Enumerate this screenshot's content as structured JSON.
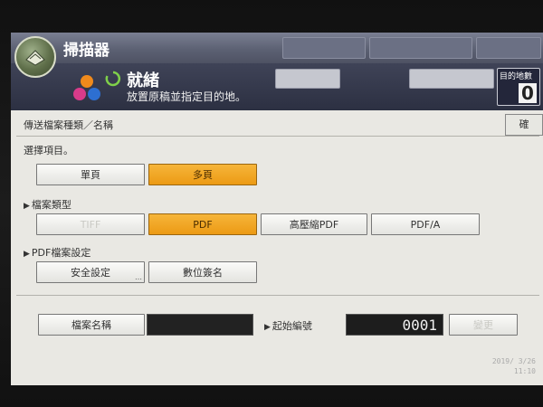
{
  "app": {
    "title": "掃描器"
  },
  "status": {
    "state": "就緒",
    "message": "放置原稿並指定目的地。",
    "destination_label": "目的地數",
    "destination_count": "0"
  },
  "panel": {
    "title": "傳送檔案種類／名稱",
    "ok_label": "確"
  },
  "select_items": {
    "label": "選擇項目。",
    "options": [
      "單頁",
      "多頁"
    ],
    "selected": "多頁"
  },
  "file_type": {
    "label": "檔案類型",
    "options": [
      "TIFF",
      "PDF",
      "高壓縮PDF",
      "PDF/A"
    ],
    "selected": "PDF"
  },
  "pdf_settings": {
    "label": "PDF檔案設定",
    "security_label": "安全設定",
    "signature_label": "數位簽名"
  },
  "file_name": {
    "button_label": "檔案名稱",
    "value": ""
  },
  "start_number": {
    "label": "起始編號",
    "value": "0001",
    "change_label": "變更"
  },
  "clock": {
    "date": "2019/ 3/26",
    "time": "11:10"
  },
  "colors": {
    "selected_button": "#f0a526",
    "status_bar": "#2c3042",
    "panel_bg": "#e9e8e3"
  }
}
